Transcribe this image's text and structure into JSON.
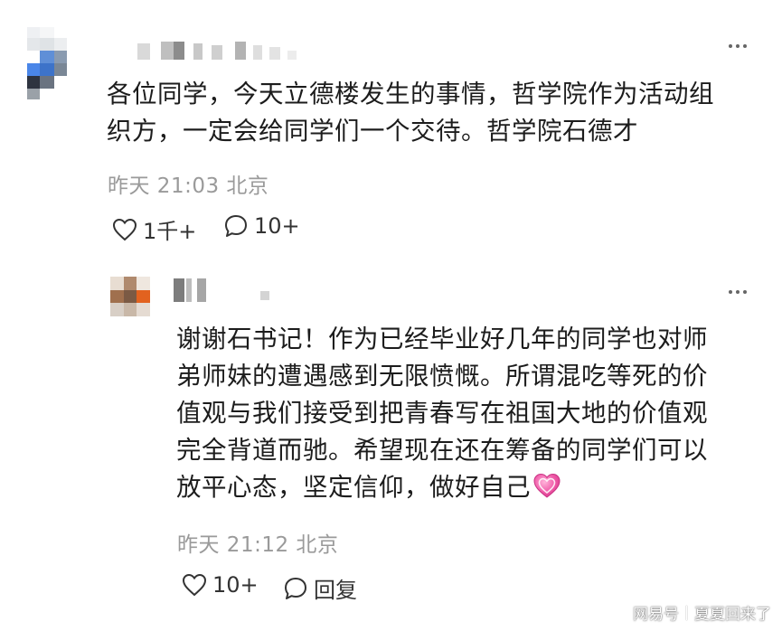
{
  "comment": {
    "text_line1": "各位同学，今天立德楼发生的事情，哲学院作为活动组",
    "text_line2": "织方，一定会给同学们一个交待。哲学院石德才",
    "time": "昨天 21:03 北京",
    "likes": "1千+",
    "replies": "10+"
  },
  "reply": {
    "text_line1": "谢谢石书记！作为已经毕业好几年的同学也对师",
    "text_line2": "弟师妹的遭遇感到无限愤慨。所谓混吃等死的价",
    "text_line3": "值观与我们接受到把青春写在祖国大地的价值观",
    "text_line4": "完全背道而驰。希望现在还在筹备的同学们可以",
    "text_line5": "放平心态，坚定信仰，做好自己",
    "time": "昨天 21:12 北京",
    "likes": "10+",
    "reply_label": "回复"
  },
  "watermark": {
    "site": "网易号",
    "author": "夏夏回来了"
  },
  "icons": {
    "like": "heart-outline-icon",
    "comment": "speech-bubble-icon",
    "more": "more-dots-icon",
    "emoji": "pink-heart-emoji"
  },
  "colors": {
    "text": "#1c1c1c",
    "meta": "#9a9a9a",
    "emoji_pink": "#f05aa8"
  }
}
